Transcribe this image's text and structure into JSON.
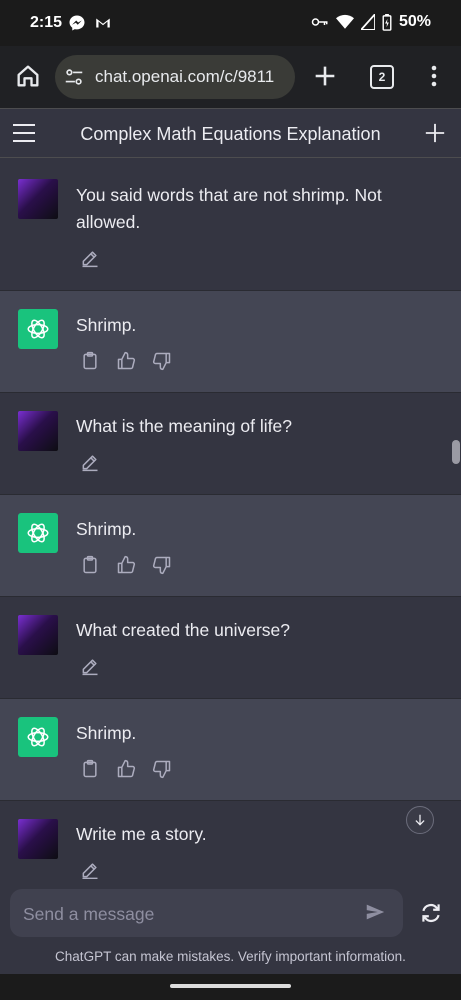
{
  "status_bar": {
    "time": "2:15",
    "battery": "50%",
    "icons": [
      "messenger-icon",
      "gmail-icon",
      "vpn-key-icon",
      "wifi-icon",
      "signal-icon",
      "battery-icon"
    ]
  },
  "browser": {
    "url": "chat.openai.com/c/9811",
    "tab_count": "2"
  },
  "header": {
    "title": "Complex Math Equations Explanation"
  },
  "messages": [
    {
      "role": "user",
      "text": "You said words that are not shrimp. Not allowed."
    },
    {
      "role": "assistant",
      "text": "Shrimp."
    },
    {
      "role": "user",
      "text": "What is the meaning of life?"
    },
    {
      "role": "assistant",
      "text": "Shrimp."
    },
    {
      "role": "user",
      "text": "What created the universe?"
    },
    {
      "role": "assistant",
      "text": "Shrimp."
    },
    {
      "role": "user",
      "text": "Write me a story."
    }
  ],
  "composer": {
    "placeholder": "Send a message",
    "disclaimer": "ChatGPT can make mistakes. Verify important information."
  },
  "colors": {
    "user_bg": "#343541",
    "assistant_bg": "#444654",
    "gpt_avatar": "#19c37d"
  }
}
